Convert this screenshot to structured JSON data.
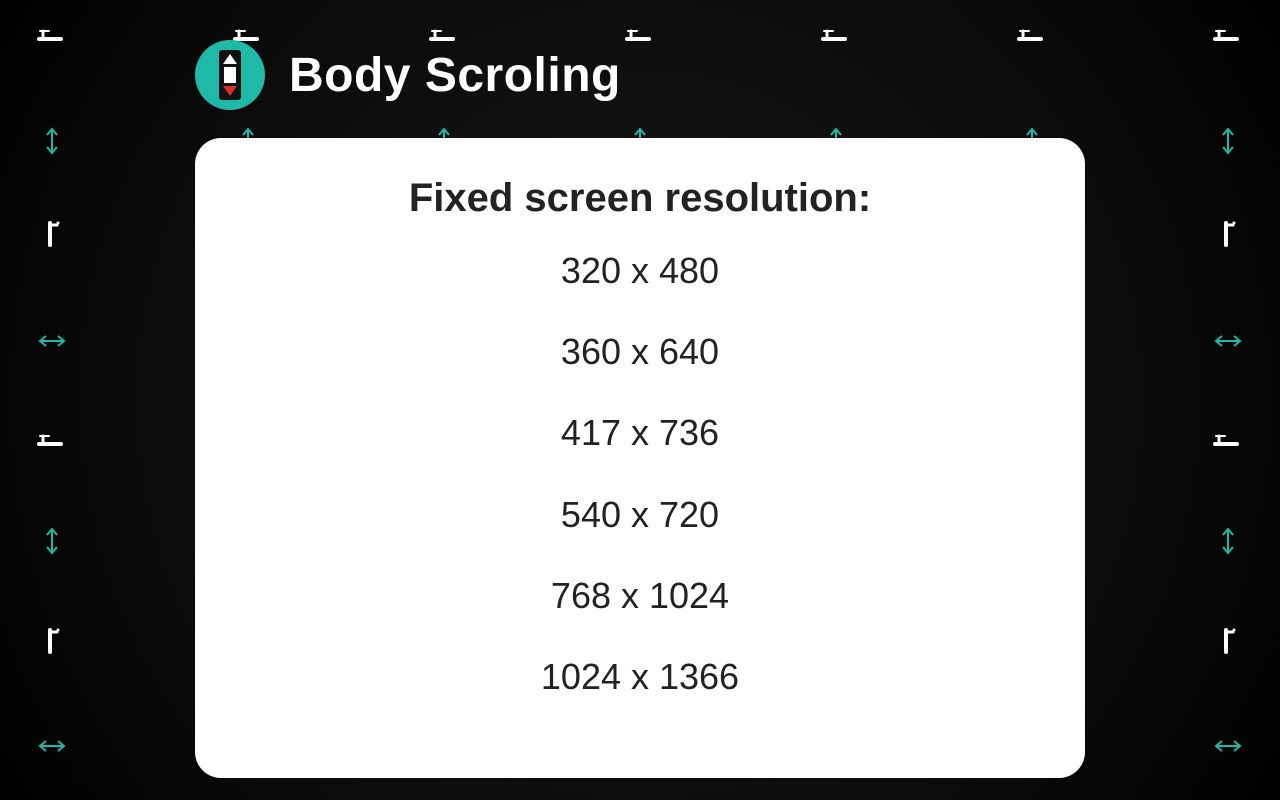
{
  "header": {
    "title": "Body Scroling",
    "icon": "scroll-icon"
  },
  "card": {
    "heading": "Fixed screen resolution:",
    "resolutions": [
      "320 x 480",
      "360 x 640",
      "417 x 736",
      "540 x 720",
      "768 x 1024",
      "1024 x 1366"
    ]
  }
}
